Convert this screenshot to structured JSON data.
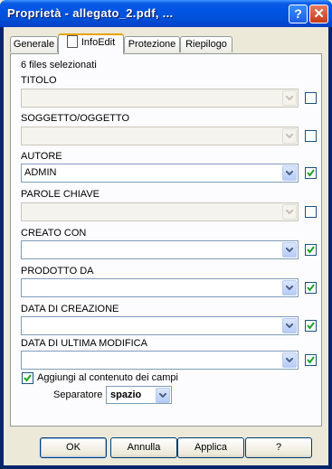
{
  "window": {
    "title": "Proprietà - allegato_2.pdf, ..."
  },
  "titlebar_buttons": {
    "help": "?",
    "close": "✕"
  },
  "tabs": [
    {
      "label": "Generale"
    },
    {
      "label": "InfoEdit"
    },
    {
      "label": "Protezione"
    },
    {
      "label": "Riepilogo"
    }
  ],
  "panel": {
    "count_text": "6 files selezionati",
    "fields": [
      {
        "label": "TITOLO",
        "value": "",
        "enabled": false,
        "checked": false
      },
      {
        "label": "SOGGETTO/OGGETTO",
        "value": "",
        "enabled": false,
        "checked": false
      },
      {
        "label": "AUTORE",
        "value": "ADMIN",
        "enabled": true,
        "checked": true
      },
      {
        "label": "PAROLE CHIAVE",
        "value": "",
        "enabled": false,
        "checked": false
      },
      {
        "label": "CREATO CON",
        "value": "",
        "enabled": true,
        "checked": true
      },
      {
        "label": "PRODOTTO DA",
        "value": "",
        "enabled": true,
        "checked": true
      },
      {
        "label": "DATA DI CREAZIONE",
        "value": "",
        "enabled": true,
        "checked": true
      },
      {
        "label": "DATA DI ULTIMA MODIFICA",
        "value": "",
        "enabled": true,
        "checked": true
      }
    ],
    "append": {
      "label": "Aggiungi al contenuto dei campi",
      "checked": true
    },
    "separator": {
      "label": "Separatore",
      "value": "spazio"
    }
  },
  "buttons": {
    "ok": "OK",
    "cancel": "Annulla",
    "apply": "Applica",
    "help": "?"
  },
  "colors": {
    "title_bar": "#0054e3",
    "panel_bg": "#fcfcfe",
    "window_bg": "#ece9d8",
    "check_green": "#21a121",
    "active_tab_accent": "#e8a202"
  }
}
